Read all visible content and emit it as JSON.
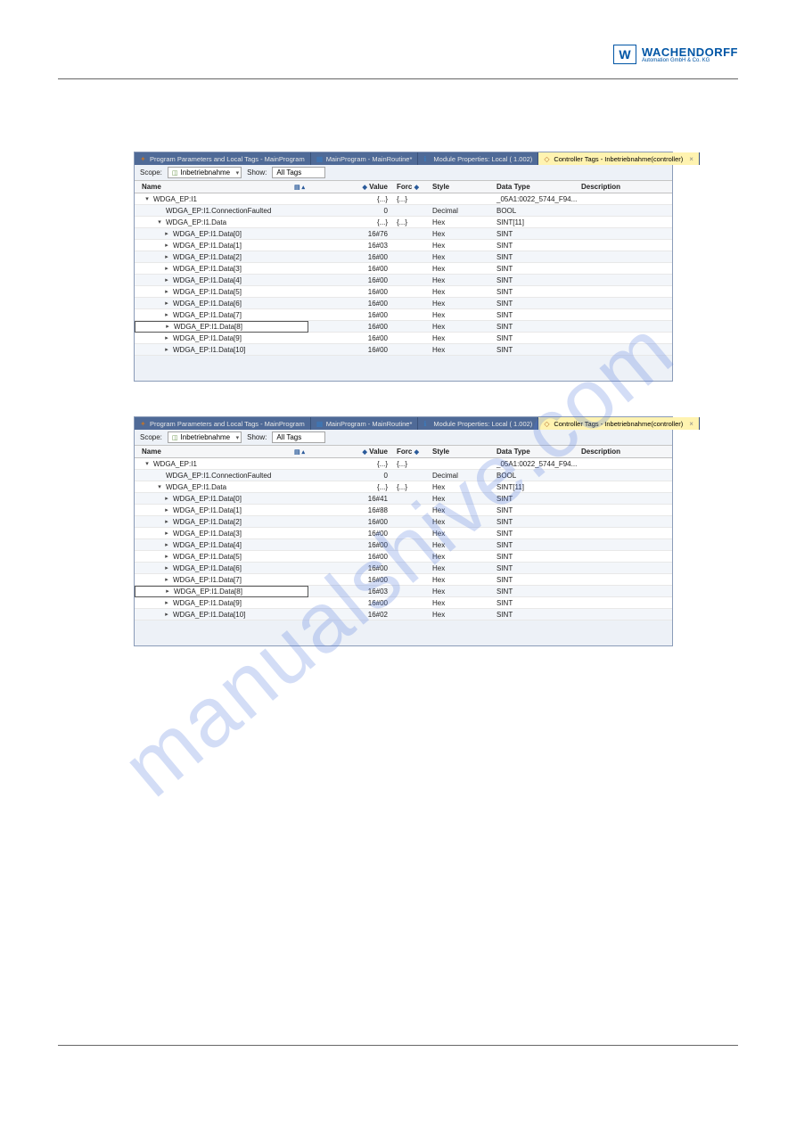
{
  "header": {
    "logo_main": "WACHENDORFF",
    "logo_sub": "Automation GmbH & Co. KG"
  },
  "watermark": "manualshive.com",
  "tabs": [
    {
      "icon": "param",
      "label": "Program Parameters and Local Tags - MainProgram"
    },
    {
      "icon": "routine",
      "label": "MainProgram - MainRoutine*"
    },
    {
      "icon": "module",
      "label": "Module Properties: Local ( 1.002)"
    },
    {
      "icon": "ctags",
      "label": "Controller Tags - Inbetriebnahme(controller)",
      "active": true,
      "closable": true
    }
  ],
  "toolbar": {
    "scope_label": "Scope:",
    "scope_value": "Inbetriebnahme",
    "show_label": "Show:",
    "show_value": "All Tags"
  },
  "grid": {
    "headers": {
      "name": "Name",
      "value": "Value",
      "force": "Forc",
      "style": "Style",
      "datatype": "Data Type",
      "description": "Description"
    }
  },
  "panel1_rows": [
    {
      "indent": 0,
      "toggle": "▾",
      "name": "WDGA_EP:I1",
      "value": "{...}",
      "force": "{...}",
      "style": "",
      "type": "_05A1:0022_5744_F94...",
      "striped": false
    },
    {
      "indent": 1,
      "toggle": "",
      "name": "WDGA_EP:I1.ConnectionFaulted",
      "value": "0",
      "force": "",
      "style": "Decimal",
      "type": "BOOL",
      "striped": true
    },
    {
      "indent": 1,
      "toggle": "▾",
      "name": "WDGA_EP:I1.Data",
      "value": "{...}",
      "force": "{...}",
      "style": "Hex",
      "type": "SINT[11]",
      "striped": false
    },
    {
      "indent": 2,
      "toggle": "▸",
      "name": "WDGA_EP:I1.Data[0]",
      "value": "16#76",
      "force": "",
      "style": "Hex",
      "type": "SINT",
      "striped": true
    },
    {
      "indent": 2,
      "toggle": "▸",
      "name": "WDGA_EP:I1.Data[1]",
      "value": "16#03",
      "force": "",
      "style": "Hex",
      "type": "SINT",
      "striped": false
    },
    {
      "indent": 2,
      "toggle": "▸",
      "name": "WDGA_EP:I1.Data[2]",
      "value": "16#00",
      "force": "",
      "style": "Hex",
      "type": "SINT",
      "striped": true
    },
    {
      "indent": 2,
      "toggle": "▸",
      "name": "WDGA_EP:I1.Data[3]",
      "value": "16#00",
      "force": "",
      "style": "Hex",
      "type": "SINT",
      "striped": false
    },
    {
      "indent": 2,
      "toggle": "▸",
      "name": "WDGA_EP:I1.Data[4]",
      "value": "16#00",
      "force": "",
      "style": "Hex",
      "type": "SINT",
      "striped": true
    },
    {
      "indent": 2,
      "toggle": "▸",
      "name": "WDGA_EP:I1.Data[5]",
      "value": "16#00",
      "force": "",
      "style": "Hex",
      "type": "SINT",
      "striped": false
    },
    {
      "indent": 2,
      "toggle": "▸",
      "name": "WDGA_EP:I1.Data[6]",
      "value": "16#00",
      "force": "",
      "style": "Hex",
      "type": "SINT",
      "striped": true
    },
    {
      "indent": 2,
      "toggle": "▸",
      "name": "WDGA_EP:I1.Data[7]",
      "value": "16#00",
      "force": "",
      "style": "Hex",
      "type": "SINT",
      "striped": false
    },
    {
      "indent": 2,
      "toggle": "▸",
      "name": "WDGA_EP:I1.Data[8]",
      "value": "16#00",
      "force": "",
      "style": "Hex",
      "type": "SINT",
      "striped": true,
      "selected": true
    },
    {
      "indent": 2,
      "toggle": "▸",
      "name": "WDGA_EP:I1.Data[9]",
      "value": "16#00",
      "force": "",
      "style": "Hex",
      "type": "SINT",
      "striped": false
    },
    {
      "indent": 2,
      "toggle": "▸",
      "name": "WDGA_EP:I1.Data[10]",
      "value": "16#00",
      "force": "",
      "style": "Hex",
      "type": "SINT",
      "striped": true
    }
  ],
  "panel2_rows": [
    {
      "indent": 0,
      "toggle": "▾",
      "name": "WDGA_EP:I1",
      "value": "{...}",
      "force": "{...}",
      "style": "",
      "type": "_05A1:0022_5744_F94...",
      "striped": false
    },
    {
      "indent": 1,
      "toggle": "",
      "name": "WDGA_EP:I1.ConnectionFaulted",
      "value": "0",
      "force": "",
      "style": "Decimal",
      "type": "BOOL",
      "striped": true
    },
    {
      "indent": 1,
      "toggle": "▾",
      "name": "WDGA_EP:I1.Data",
      "value": "{...}",
      "force": "{...}",
      "style": "Hex",
      "type": "SINT[11]",
      "striped": false
    },
    {
      "indent": 2,
      "toggle": "▸",
      "name": "WDGA_EP:I1.Data[0]",
      "value": "16#41",
      "force": "",
      "style": "Hex",
      "type": "SINT",
      "striped": true
    },
    {
      "indent": 2,
      "toggle": "▸",
      "name": "WDGA_EP:I1.Data[1]",
      "value": "16#88",
      "force": "",
      "style": "Hex",
      "type": "SINT",
      "striped": false
    },
    {
      "indent": 2,
      "toggle": "▸",
      "name": "WDGA_EP:I1.Data[2]",
      "value": "16#00",
      "force": "",
      "style": "Hex",
      "type": "SINT",
      "striped": true
    },
    {
      "indent": 2,
      "toggle": "▸",
      "name": "WDGA_EP:I1.Data[3]",
      "value": "16#00",
      "force": "",
      "style": "Hex",
      "type": "SINT",
      "striped": false
    },
    {
      "indent": 2,
      "toggle": "▸",
      "name": "WDGA_EP:I1.Data[4]",
      "value": "16#00",
      "force": "",
      "style": "Hex",
      "type": "SINT",
      "striped": true
    },
    {
      "indent": 2,
      "toggle": "▸",
      "name": "WDGA_EP:I1.Data[5]",
      "value": "16#00",
      "force": "",
      "style": "Hex",
      "type": "SINT",
      "striped": false
    },
    {
      "indent": 2,
      "toggle": "▸",
      "name": "WDGA_EP:I1.Data[6]",
      "value": "16#00",
      "force": "",
      "style": "Hex",
      "type": "SINT",
      "striped": true
    },
    {
      "indent": 2,
      "toggle": "▸",
      "name": "WDGA_EP:I1.Data[7]",
      "value": "16#00",
      "force": "",
      "style": "Hex",
      "type": "SINT",
      "striped": false
    },
    {
      "indent": 2,
      "toggle": "▸",
      "name": "WDGA_EP:I1.Data[8]",
      "value": "16#03",
      "force": "",
      "style": "Hex",
      "type": "SINT",
      "striped": true,
      "selected": true
    },
    {
      "indent": 2,
      "toggle": "▸",
      "name": "WDGA_EP:I1.Data[9]",
      "value": "16#00",
      "force": "",
      "style": "Hex",
      "type": "SINT",
      "striped": false
    },
    {
      "indent": 2,
      "toggle": "▸",
      "name": "WDGA_EP:I1.Data[10]",
      "value": "16#02",
      "force": "",
      "style": "Hex",
      "type": "SINT",
      "striped": true
    }
  ]
}
